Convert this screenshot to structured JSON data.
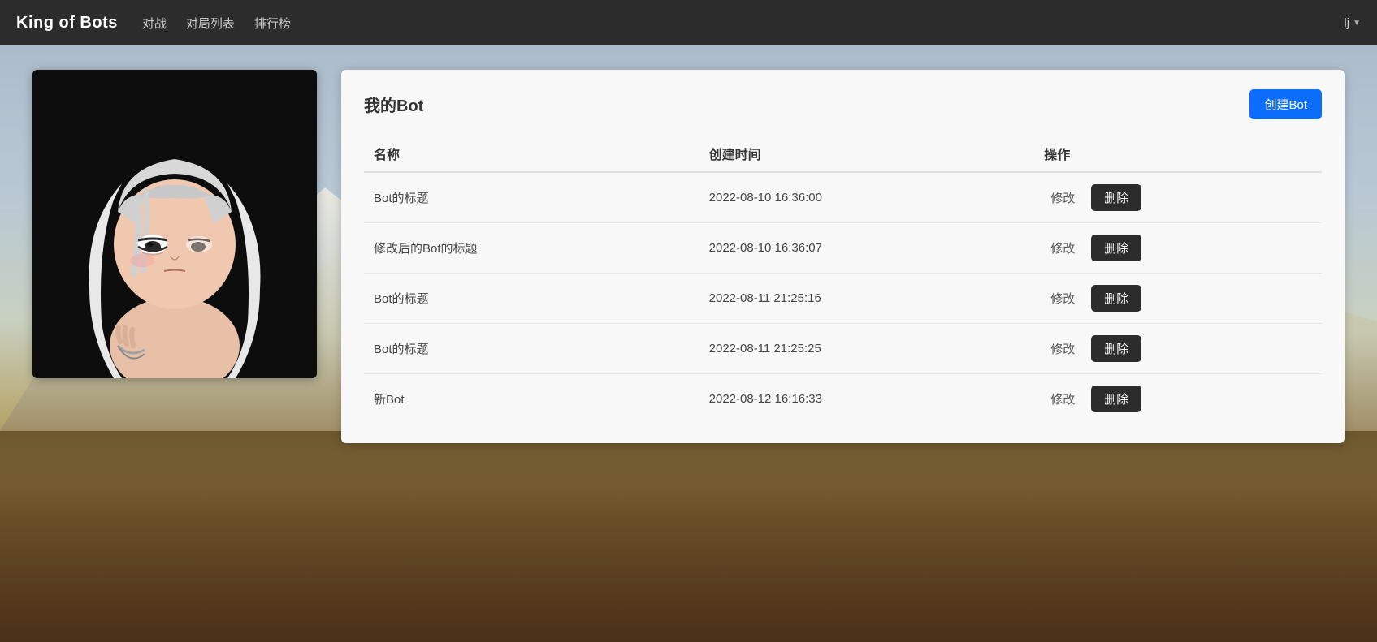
{
  "navbar": {
    "brand": "King of Bots",
    "links": [
      {
        "label": "对战",
        "id": "nav-battle"
      },
      {
        "label": "对局列表",
        "id": "nav-game-list"
      },
      {
        "label": "排行榜",
        "id": "nav-ranking"
      }
    ],
    "user": "lj",
    "dropdown_arrow": "▼"
  },
  "page": {
    "title": "我的Bot",
    "create_button": "创建Bot",
    "table": {
      "columns": [
        {
          "id": "name",
          "label": "名称"
        },
        {
          "id": "created_at",
          "label": "创建时间"
        },
        {
          "id": "actions",
          "label": "操作"
        }
      ],
      "rows": [
        {
          "name": "Bot的标题",
          "created_at": "2022-08-10 16:36:00"
        },
        {
          "name": "修改后的Bot的标题",
          "created_at": "2022-08-10 16:36:07"
        },
        {
          "name": "Bot的标题",
          "created_at": "2022-08-11 21:25:16"
        },
        {
          "name": "Bot的标题",
          "created_at": "2022-08-11 21:25:25"
        },
        {
          "name": "新Bot",
          "created_at": "2022-08-12 16:16:33"
        }
      ],
      "edit_label": "修改",
      "delete_label": "删除"
    }
  }
}
